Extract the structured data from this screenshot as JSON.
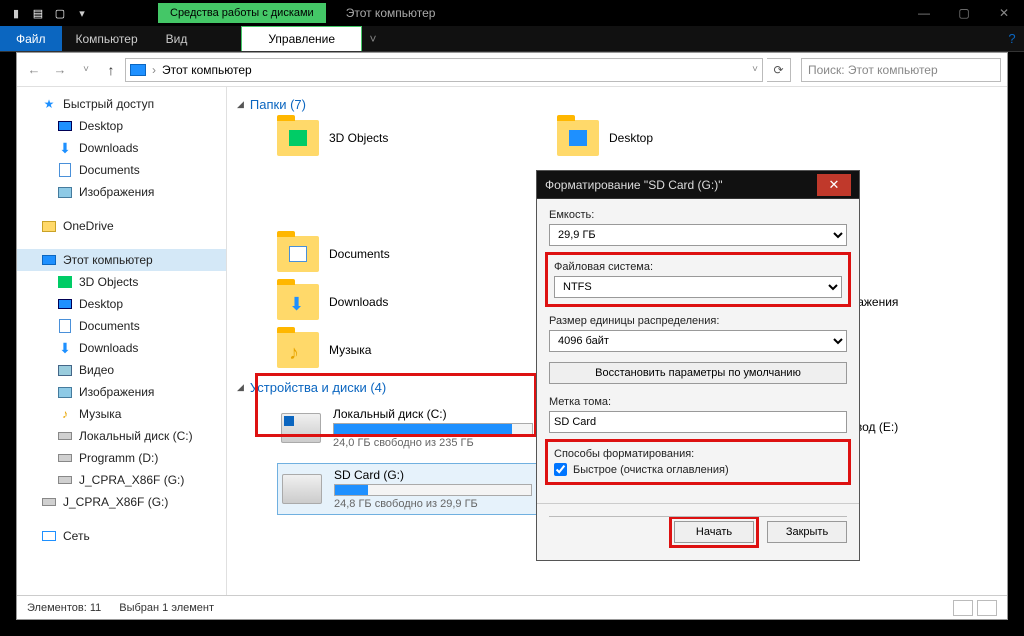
{
  "titlebar": {
    "tool_tab": "Средства работы с дисками",
    "window_title": "Этот компьютер"
  },
  "ribbon": {
    "file": "Файл",
    "tabs": [
      "Компьютер",
      "Вид"
    ],
    "manage": "Управление"
  },
  "address": {
    "location": "Этот компьютер",
    "search_placeholder": "Поиск: Этот компьютер"
  },
  "nav": {
    "quick": "Быстрый доступ",
    "desktop": "Desktop",
    "downloads": "Downloads",
    "documents": "Documents",
    "pictures": "Изображения",
    "onedrive": "OneDrive",
    "thispc": "Этот компьютер",
    "threed": "3D Objects",
    "desktop2": "Desktop",
    "documents2": "Documents",
    "downloads2": "Downloads",
    "video": "Видео",
    "pictures2": "Изображения",
    "music": "Музыка",
    "localdisk": "Локальный диск (C:)",
    "programm": "Programm (D:)",
    "sd1": "J_CPRA_X86F (G:)",
    "sd2": "J_CPRA_X86F (G:)",
    "network": "Сеть"
  },
  "folders_hdr": "Папки (7)",
  "folders": {
    "f1": "3D Objects",
    "f2": "Desktop",
    "f3": "Documents",
    "f4": "Downloads",
    "f5": "Музыка",
    "f6": "ображения"
  },
  "drives_hdr": "Устройства и диски (4)",
  "drives": {
    "c": {
      "name": "Локальный диск (C:)",
      "free": "24,0 ГБ свободно из 235 ГБ",
      "pct": 90
    },
    "g": {
      "name": "SD Card (G:)",
      "free": "24,8 ГБ свободно из 29,9 ГБ",
      "pct": 17
    },
    "e": {
      "name": "RW дисковод (E:)"
    }
  },
  "status": {
    "items": "Элементов: 11",
    "selected": "Выбран 1 элемент"
  },
  "dialog": {
    "title": "Форматирование \"SD Card (G:)\"",
    "capacity_label": "Емкость:",
    "capacity_value": "29,9 ГБ",
    "fs_label": "Файловая система:",
    "fs_value": "NTFS",
    "alloc_label": "Размер единицы распределения:",
    "alloc_value": "4096 байт",
    "restore": "Восстановить параметры по умолчанию",
    "volume_label": "Метка тома:",
    "volume_value": "SD Card",
    "methods_label": "Способы форматирования:",
    "quick": "Быстрое (очистка оглавления)",
    "start": "Начать",
    "close": "Закрыть"
  }
}
